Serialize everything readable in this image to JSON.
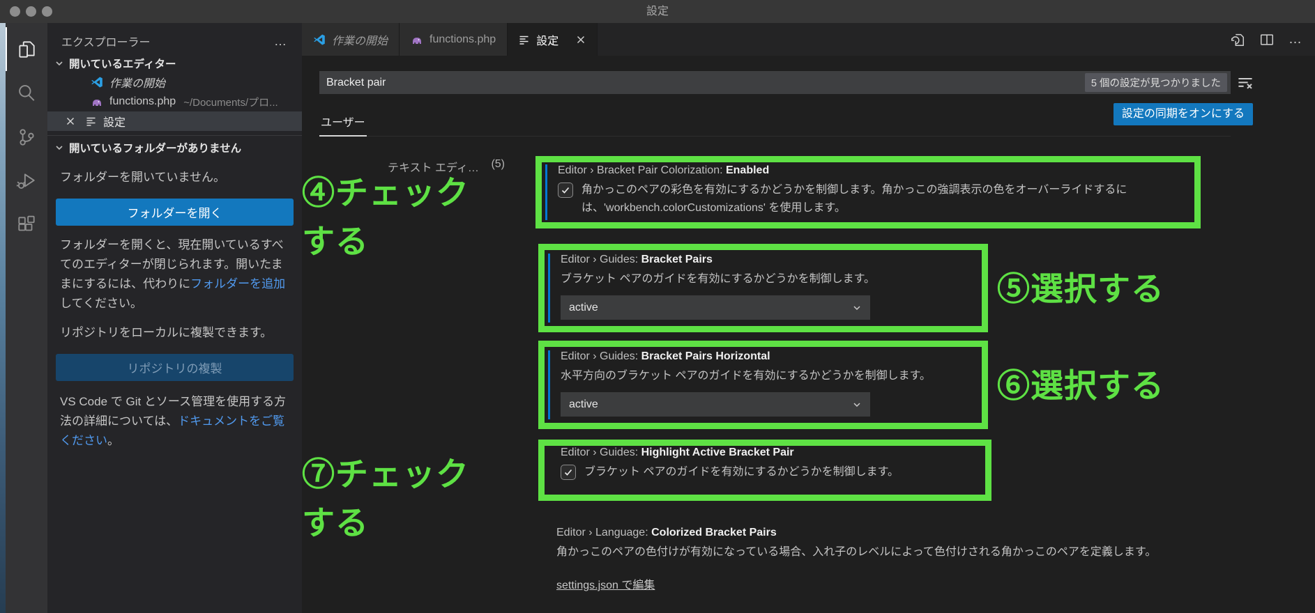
{
  "window": {
    "title": "設定"
  },
  "colors": {
    "annotation_green": "#5ee144",
    "modified_bar_blue": "#0078d4",
    "primary_button_blue": "#1378be",
    "link_blue": "#519aef"
  },
  "activity_bar": {
    "items": [
      "explorer",
      "search",
      "source-control",
      "run-and-debug",
      "extensions"
    ],
    "active": "explorer"
  },
  "sidebar": {
    "header": "エクスプローラー",
    "more_label": "…",
    "open_editors_section": "開いているエディター",
    "open_editors": [
      {
        "label": "作業の開始"
      },
      {
        "label": "functions.php",
        "path": "~/Documents/プロ..."
      },
      {
        "label": "設定"
      }
    ],
    "no_folder_section": "開いているフォルダーがありません",
    "no_folder_text": "フォルダーを開いていません。",
    "open_folder_button": "フォルダーを開く",
    "close_warning_before": "フォルダーを開くと、現在開いているすべてのエディターが閉じられます。開いたままにするには、代わりに",
    "close_warning_link": "フォルダーを追加",
    "close_warning_after": "してください。",
    "clone_text": "リポジトリをローカルに複製できます。",
    "clone_button": "リポジトリの複製",
    "git_doc_before": "VS Code で Git とソース管理を使用する方法の詳細については、",
    "git_doc_link": "ドキュメントをご覧ください",
    "git_doc_after": "。"
  },
  "tabs": [
    {
      "label": "作業の開始"
    },
    {
      "label": "functions.php"
    },
    {
      "label": "設定",
      "active": true
    }
  ],
  "editor_actions": {
    "more_label": "…"
  },
  "settings": {
    "search_value": "Bracket pair",
    "results_badge": "5 個の設定が見つかりました",
    "scope_tab": "ユーザー",
    "sync_button": "設定の同期をオンにする",
    "toc": {
      "label": "テキスト エディ…",
      "count": "(5)"
    },
    "items": [
      {
        "category": "Editor › Bracket Pair Colorization:",
        "name": "Enabled",
        "type": "checkbox",
        "checked": true,
        "modified": true,
        "description": "角かっこのペアの彩色を有効にするかどうかを制御します。角かっこの強調表示の色をオーバーライドするには、'workbench.colorCustomizations' を使用します。"
      },
      {
        "category": "Editor › Guides:",
        "name": "Bracket Pairs",
        "type": "select",
        "value": "active",
        "modified": true,
        "description": "ブラケット ペアのガイドを有効にするかどうかを制御します。"
      },
      {
        "category": "Editor › Guides:",
        "name": "Bracket Pairs Horizontal",
        "type": "select",
        "value": "active",
        "modified": true,
        "description": "水平方向のブラケット ペアのガイドを有効にするかどうかを制御します。"
      },
      {
        "category": "Editor › Guides:",
        "name": "Highlight Active Bracket Pair",
        "type": "checkbox",
        "checked": true,
        "modified": false,
        "description": "ブラケット ペアのガイドを有効にするかどうかを制御します。"
      },
      {
        "category": "Editor › Language:",
        "name": "Colorized Bracket Pairs",
        "type": "link",
        "description": "角かっこのペアの色付けが有効になっている場合、入れ子のレベルによって色付けされる角かっこのペアを定義します。",
        "link_label": "settings.json で編集"
      }
    ]
  },
  "annotations": {
    "step4": "④チェック\nする",
    "step5": "⑤選択する",
    "step6": "⑥選択する",
    "step7": "⑦チェック\nする"
  }
}
